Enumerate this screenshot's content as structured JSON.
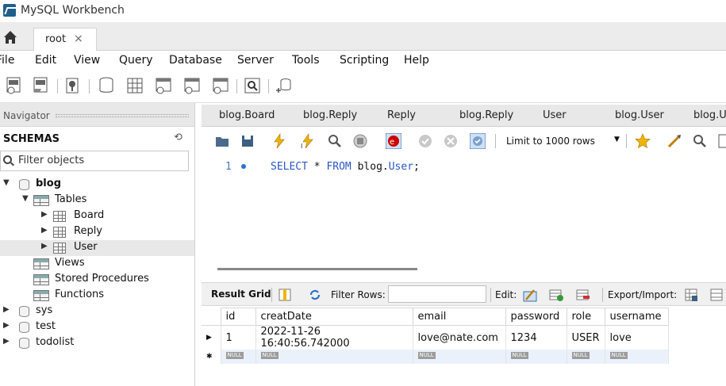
{
  "app": {
    "title": "MySQL Workbench"
  },
  "connection_tab": {
    "label": "root",
    "close": "×"
  },
  "menu": [
    "File",
    "Edit",
    "View",
    "Query",
    "Database",
    "Server",
    "Tools",
    "Scripting",
    "Help"
  ],
  "navigator": {
    "header": "Navigator",
    "schemas_label": "SCHEMAS",
    "filter_placeholder": "Filter objects",
    "tree": {
      "blog": "blog",
      "tables": "Tables",
      "board": "Board",
      "reply": "Reply",
      "user": "User",
      "views": "Views",
      "stored_procedures": "Stored Procedures",
      "functions": "Functions",
      "sys": "sys",
      "test": "test",
      "todolist": "todolist"
    }
  },
  "editor_tabs": [
    "blog.Board",
    "blog.Reply",
    "Reply",
    "blog.Reply",
    "User",
    "blog.User",
    "blog.U"
  ],
  "sql_toolbar": {
    "limit": "Limit to 1000 rows"
  },
  "editor": {
    "line_number": "1",
    "sql_keyword1": "SELECT",
    "sql_star": " * ",
    "sql_keyword2": "FROM",
    "sql_schema": " blog.",
    "sql_table": "User",
    "sql_end": ";"
  },
  "result_bar": {
    "result_grid": "Result Grid",
    "filter_rows": "Filter Rows:",
    "edit": "Edit:",
    "export_import": "Export/Import:"
  },
  "grid": {
    "columns": [
      "id",
      "creatDate",
      "email",
      "password",
      "role",
      "username"
    ],
    "rows": [
      [
        "1",
        "2022-11-26 16:40:56.742000",
        "love@nate.com",
        "1234",
        "USER",
        "love"
      ]
    ],
    "null_label": "NULL"
  }
}
